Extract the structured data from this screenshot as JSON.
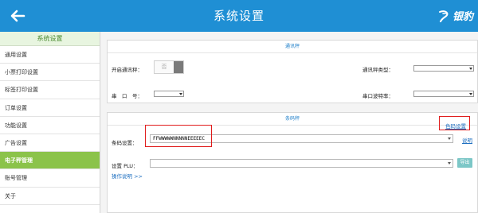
{
  "header": {
    "title": "系统设置",
    "brand": "银豹"
  },
  "sidebar": {
    "title": "系统设置",
    "items": [
      {
        "label": "通用设置"
      },
      {
        "label": "小票打印设置"
      },
      {
        "label": "标签打印设置"
      },
      {
        "label": "订单设置"
      },
      {
        "label": "功能设置"
      },
      {
        "label": "广告设置"
      },
      {
        "label": "电子秤管理"
      },
      {
        "label": "账号管理"
      },
      {
        "label": "关于"
      }
    ],
    "active_index": 6
  },
  "comm_panel": {
    "title": "通讯秤",
    "enable_label": "开启通讯秤：",
    "toggle_text": "否",
    "scale_type_label": "通讯秤类型：",
    "serial_port_label": "串　口　号：",
    "baud_rate_label": "串口波特率："
  },
  "barcode_panel": {
    "title": "条码秤",
    "color_settings_link": "色码设置",
    "barcode_label": "条码设置：",
    "barcode_value": "FFWWWWWNNNNNEEEEEC",
    "explain_link": "说明",
    "plu_label": "设置 PLU：",
    "export_button": "导出",
    "usage_link": "操作说明 >>"
  },
  "colors": {
    "header": "#1f8fd4",
    "active_item": "#8bc34a",
    "highlight": "#e01b1b"
  }
}
